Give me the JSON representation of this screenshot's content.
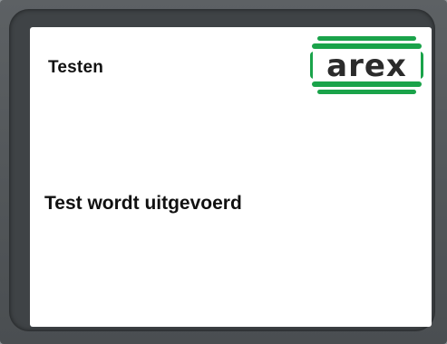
{
  "screen": {
    "title": "Testen",
    "message": "Test wordt uitgevoerd"
  },
  "logo": {
    "text": "arex",
    "icon": "arex-logo",
    "colors": {
      "green": "#1aa34a",
      "dark": "#2b2b2b"
    }
  }
}
